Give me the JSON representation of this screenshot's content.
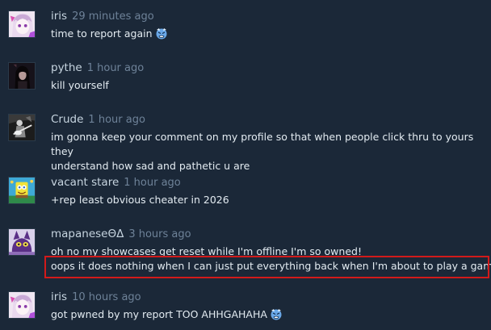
{
  "comments": [
    {
      "author": "iris",
      "time": "29 minutes ago",
      "lines": [
        "time to report again"
      ],
      "emoticon": "angry-blue-face-emoticon",
      "avatar": "anime-girl-pink-avatar"
    },
    {
      "author": "pythe",
      "time": "1 hour ago",
      "lines": [
        "kill yourself"
      ],
      "avatar": "dark-hair-girl-avatar"
    },
    {
      "author": "Crude",
      "time": "1 hour ago",
      "lines": [
        "im gonna keep your comment on my profile so that when people click thru to yours they",
        "understand how sad and pathetic u are"
      ],
      "avatar": "guitarist-bw-avatar"
    },
    {
      "author": "vacant stare",
      "time": "1 hour ago",
      "lines": [
        "+rep least obvious cheater in 2026"
      ],
      "avatar": "spongebob-avatar"
    },
    {
      "author": "mapaneseΘΔ",
      "time": "3 hours ago",
      "lines": [
        "oh no my showcases get reset while I'm offline I'm so owned!",
        "oops it does nothing when I can just put everything back when I'm about to play a game."
      ],
      "avatar": "purple-cat-avatar"
    },
    {
      "author": "iris",
      "time": "10 hours ago",
      "lines": [
        "got pwned by my report TOO AHHGAHAHA"
      ],
      "emoticon": "angry-blue-face-emoticon",
      "avatar": "anime-girl-pink-avatar"
    }
  ],
  "colors": {
    "background": "#1b2838",
    "highlight_border": "#d21a1a",
    "timestamp": "#6e8298",
    "text": "#e3ebf1"
  }
}
